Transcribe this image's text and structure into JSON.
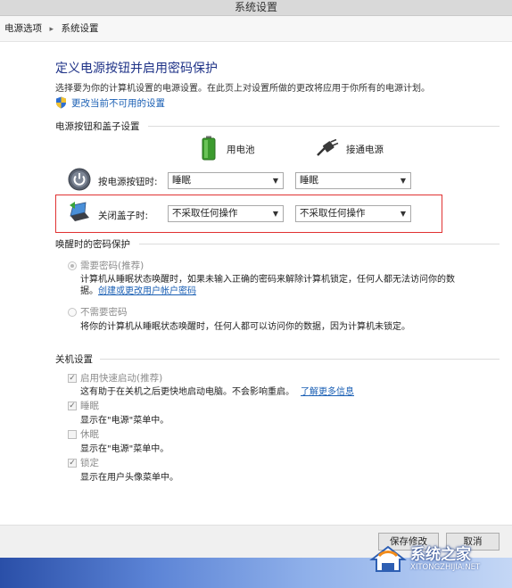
{
  "window": {
    "title": "系统设置"
  },
  "breadcrumb": {
    "items": [
      "电源选项",
      "系统设置"
    ]
  },
  "header": {
    "title": "定义电源按钮并启用密码保护",
    "description": "选择要为你的计算机设置的电源设置。在此页上对设置所做的更改将应用于你所有的电源计划。",
    "change_link": "更改当前不可用的设置"
  },
  "power_section": {
    "heading": "电源按钮和盖子设置",
    "col_battery": "用电池",
    "col_plugged": "接通电源",
    "rows": [
      {
        "label": "按电源按钮时:",
        "battery": "睡眠",
        "plugged": "睡眠"
      },
      {
        "label": "关闭盖子时:",
        "battery": "不采取任何操作",
        "plugged": "不采取任何操作"
      }
    ]
  },
  "password_section": {
    "heading": "唤醒时的密码保护",
    "require_label": "需要密码(推荐)",
    "require_desc": "计算机从睡眠状态唤醒时，如果未输入正确的密码来解除计算机锁定，任何人都无法访问你的数",
    "require_desc_2": "据。",
    "require_link": "创建或更改用户帐户密码",
    "no_require_label": "不需要密码",
    "no_require_desc": "将你的计算机从睡眠状态唤醒时，任何人都可以访问你的数据，因为计算机未锁定。"
  },
  "shutdown_section": {
    "heading": "关机设置",
    "items": [
      {
        "label": "启用快速启动(推荐)",
        "desc": "这有助于在关机之后更快地启动电脑。不会影响重启。",
        "link": "了解更多信息",
        "checked": true
      },
      {
        "label": "睡眠",
        "desc": "显示在\"电源\"菜单中。",
        "checked": true
      },
      {
        "label": "休眠",
        "desc": "显示在\"电源\"菜单中。",
        "checked": false
      },
      {
        "label": "锁定",
        "desc": "显示在用户头像菜单中。",
        "checked": true
      }
    ]
  },
  "footer": {
    "save_label": "保存修改",
    "cancel_label": "取消"
  },
  "watermark": {
    "brand": "系统之家",
    "url": "XITONGZHIJIA.NET"
  },
  "colors": {
    "title": "#1e3287",
    "link": "#1a5fb4",
    "highlight": "#e03232"
  }
}
